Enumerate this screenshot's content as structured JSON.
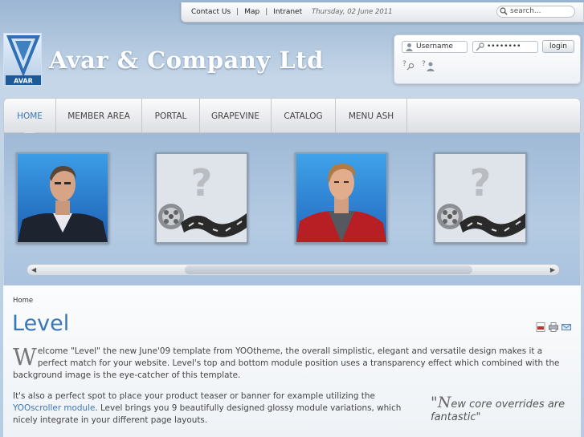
{
  "topbar": {
    "links": [
      "Contact Us",
      "Map",
      "Intranet"
    ],
    "date": "Thursday, 02 June 2011",
    "search_placeholder": "search..."
  },
  "logo": {
    "badge_text": "AVAR",
    "company_name": "Avar & Company Ltd"
  },
  "login": {
    "username_placeholder": "Username",
    "password_value": "••••••••",
    "login_label": "login"
  },
  "nav": {
    "items": [
      {
        "label": "HOME",
        "active": true
      },
      {
        "label": "MEMBER AREA",
        "active": false
      },
      {
        "label": "PORTAL",
        "active": false
      },
      {
        "label": "GRAPEVINE",
        "active": false
      },
      {
        "label": "CATALOG",
        "active": false
      },
      {
        "label": "MENU ASH",
        "active": false
      }
    ]
  },
  "scroller": {
    "items": [
      "man-portrait",
      "video-placeholder",
      "young-man-portrait",
      "video-placeholder"
    ]
  },
  "content": {
    "breadcrumb": "Home",
    "title": "Level",
    "para1_dropcap": "W",
    "para1": "elcome \"Level\" the new June'09 template from YOOtheme, the overall simplistic, elegant and versatile design makes it a perfect match for your website. Level's top and bottom module position uses a transparency effect which combined with the background image is the eye-catcher of this template.",
    "para2_start": "It's also a perfect spot to place your product teaser or banner for example utilizing the ",
    "para2_link": "YOOscroller module",
    "para2_end": ". Level brings you 9 beautifully designed glossy module variations, which nicely integrate in your different page layouts.",
    "quote_open": "\"",
    "quote_capital": "N",
    "quote_text": "ew core overrides are fantastic\""
  },
  "colors": {
    "accent": "#3a78b5",
    "background": "#b7cce2"
  }
}
